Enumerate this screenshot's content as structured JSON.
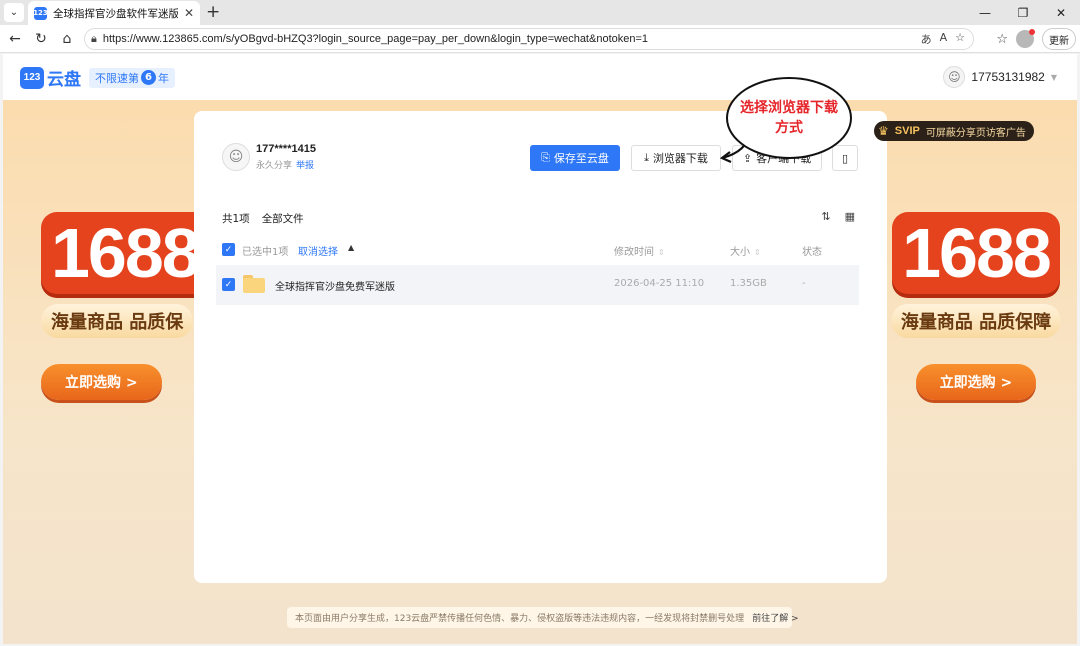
{
  "browser": {
    "tab_title": "全球指挥官沙盘软件军迷版_123云盘",
    "tab_favicon": "123",
    "url": "https://www.123865.com/s/yOBgvd-bHZQ3?login_source_page=pay_per_down&login_type=wechat&notoken=1",
    "update_label": "更新"
  },
  "site": {
    "logo_mark": "123",
    "logo_text": "云盘",
    "badge_prefix": "不限速第",
    "badge_number": "6",
    "badge_suffix": "年",
    "user_name": "17753131982"
  },
  "share": {
    "sharer_name": "177****1415",
    "share_type": "永久分享",
    "report_label": "举报"
  },
  "actions": {
    "save_label": "保存至云盘",
    "browser_download_label": "浏览器下载",
    "client_download_label": "客户端下载"
  },
  "list": {
    "count_label": "共1项",
    "all_files_label": "全部文件",
    "selected_label": "已选中1项",
    "cancel_label": "取消选择",
    "col_modified": "修改时间",
    "col_size": "大小",
    "col_status": "状态",
    "rows": [
      {
        "name": "全球指挥官沙盘免费军迷版",
        "modified": "2026-04-25 11:10",
        "size": "1.35GB",
        "status": "-"
      }
    ]
  },
  "annotation": {
    "text": "选择浏览器下载方式"
  },
  "svip": {
    "label": "SVIP",
    "text": "可屏蔽分享页访客广告"
  },
  "promo": {
    "number": "1688",
    "subtitle": "海量商品 品质保障",
    "subtitle_left": "海量商品 品质保",
    "button": "立即选购 >"
  },
  "footer": {
    "notice": "本页面由用户分享生成，123云盘严禁传播任何色情、暴力、侵权盗版等违法违规内容，一经发现将封禁删号处理",
    "link": "前往了解 >"
  },
  "colors": {
    "brand": "#2e77f6",
    "annotation": "#e5252a"
  }
}
